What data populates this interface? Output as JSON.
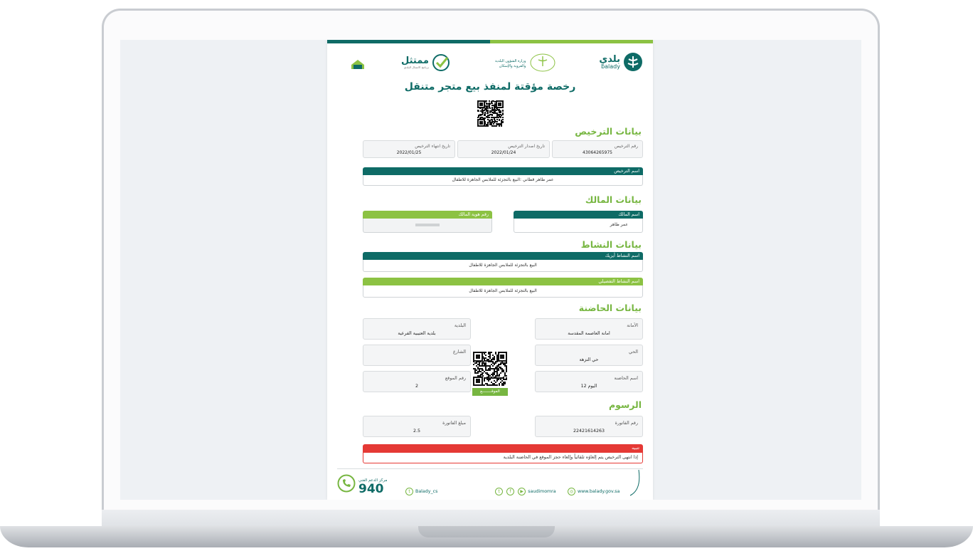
{
  "header": {
    "balady_ar": "بلدي",
    "balady_en": "balady",
    "ministry_line1": "وزارة الشؤون البلدية",
    "ministry_line2": "والقروية والإسكان",
    "mumtathil": "ممتثل",
    "mumtathil_sub": "برنامج الامتثال البلدي"
  },
  "title": "رخصة مؤقتة لمنفذ بيع متجر متنقل",
  "license": {
    "section": "بيانات الترخيص",
    "number_label": "رقم الترخيص",
    "number": "43064265975",
    "issue_label": "تاريخ اصدار الترخيص",
    "issue_date": "2022/01/24",
    "expiry_label": "تاريخ انتهاء الترخيص",
    "expiry_date": "2022/01/25",
    "name_label": "اسم الترخيص",
    "name_value": "عمر طاهر قطاني :البيع  بالتجزئة للملابس الجاهزة للاطفال"
  },
  "owner": {
    "section": "بيانات المالك",
    "name_label": "اسم المالك",
    "name_value": "عمر طاهر",
    "id_label": "رقم هوية المالك"
  },
  "activity": {
    "section": "بيانات النشاط",
    "isic_label": "اسم النشاط أيزيك",
    "isic_value": "البيع  بالتجزئة للملابس الجاهزة للاطفال",
    "detail_label": "اسم النشاط التفصيلي",
    "detail_value": "البيع  بالتجزئة للملابس الجاهزة للاطفال"
  },
  "incubator": {
    "section": "بيانات الحاضنة",
    "amanah_label": "الأمانة",
    "amanah_value": "امانة العاصمة المقدسة",
    "municipality_label": "البلدية",
    "municipality_value": "بلدية العتيبية الفرعية",
    "district_label": "الحي",
    "district_value": "حي النزهة",
    "street_label": "الشارع",
    "street_value": "",
    "incubator_name_label": "اسم الحاضنة",
    "incubator_name_value": "اليوم 12",
    "site_no_label": "رقم الموقع",
    "site_no_value": "2",
    "location_btn": "الموقــــــــع"
  },
  "fees": {
    "section": "الرسوم",
    "invoice_no_label": "رقم الفاتورة",
    "invoice_no": "22421614263",
    "invoice_amount_label": "مبلغ الفاتورة",
    "invoice_amount": "2.5"
  },
  "notice": {
    "label": "تنبيه",
    "text": "إذا انتهى الترخيص يتم إلغاؤه تلقائياً وإلغاء حجز الموقع في الحاضنة البلدية"
  },
  "footer": {
    "support_label": "مركز الدعم الفني",
    "support_number": "940",
    "twitter_cs": "Balady_cs",
    "social": "saudimomra",
    "website": "www.balady.gov.sa"
  }
}
